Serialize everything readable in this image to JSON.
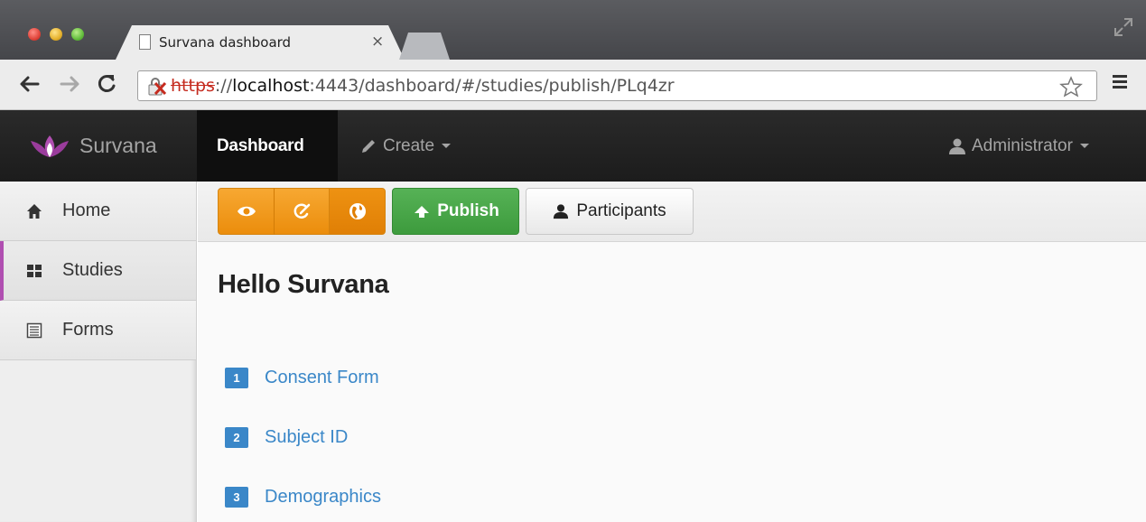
{
  "browser": {
    "tab_title": "Survana dashboard",
    "tab_close": "×",
    "url_scheme": "https",
    "url_sep": "://",
    "url_host": "localhost",
    "url_rest": ":4443/dashboard/#/studies/publish/PLq4zr"
  },
  "navbar": {
    "brand": "Survana",
    "dashboard": "Dashboard",
    "create": "Create",
    "user": "Administrator"
  },
  "sidebar": {
    "items": [
      {
        "label": "Home",
        "icon": "home-icon"
      },
      {
        "label": "Studies",
        "icon": "grid-icon",
        "active": true
      },
      {
        "label": "Forms",
        "icon": "list-icon"
      }
    ]
  },
  "actions": {
    "publish": "Publish",
    "participants": "Participants"
  },
  "main": {
    "heading": "Hello Survana",
    "forms": [
      {
        "num": "1",
        "name": "Consent Form"
      },
      {
        "num": "2",
        "name": "Subject ID"
      },
      {
        "num": "3",
        "name": "Demographics"
      }
    ]
  },
  "colors": {
    "accent": "#b04fb1",
    "link": "#3a87c8",
    "orange": "#f0981a",
    "green": "#47a447",
    "navbar": "#222222"
  }
}
